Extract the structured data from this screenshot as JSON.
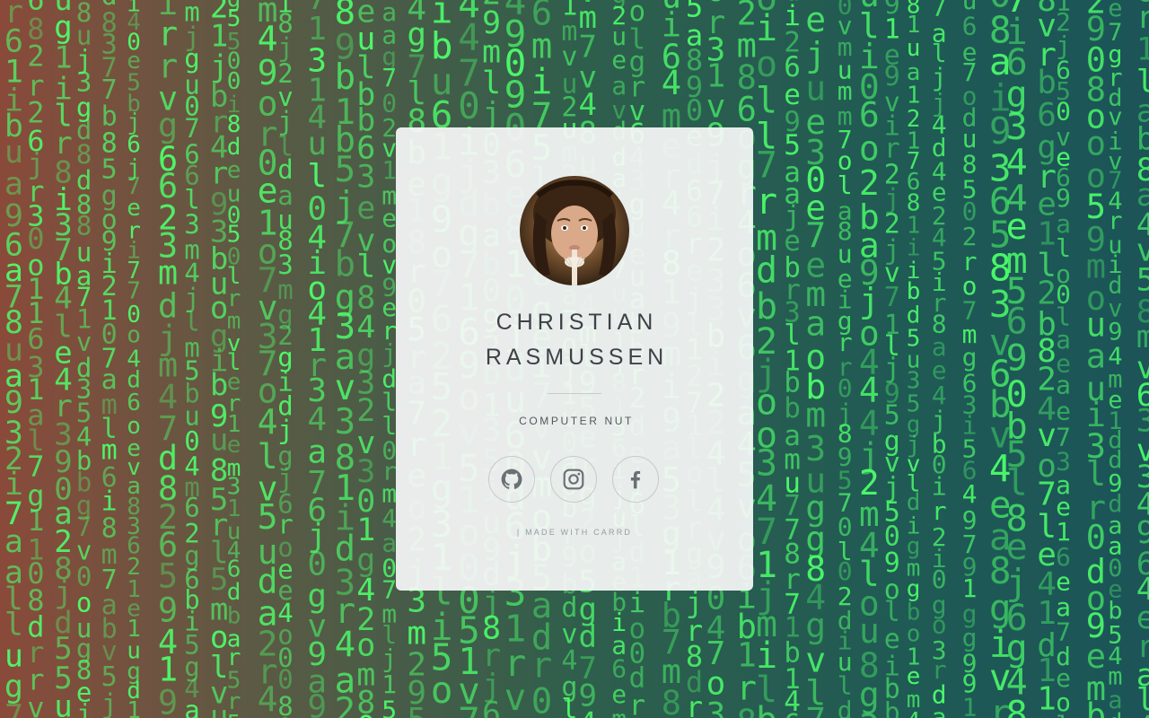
{
  "profile": {
    "name_line1": "CHRISTIAN",
    "name_line2": "RASMUSSEN",
    "tagline": "COMPUTER NUT",
    "avatar_alt": "Christian Rasmussen"
  },
  "social": [
    {
      "icon": "github-icon",
      "label": "GitHub"
    },
    {
      "icon": "instagram-icon",
      "label": "Instagram"
    },
    {
      "icon": "facebook-icon",
      "label": "Facebook"
    }
  ],
  "footer": {
    "credit": "| MADE WITH CARRD"
  },
  "background": {
    "style": "matrix-digital-rain",
    "glyph_color": "#4cff6a",
    "gradient_left": "#8a4a3a",
    "gradient_right": "#1c5458"
  }
}
